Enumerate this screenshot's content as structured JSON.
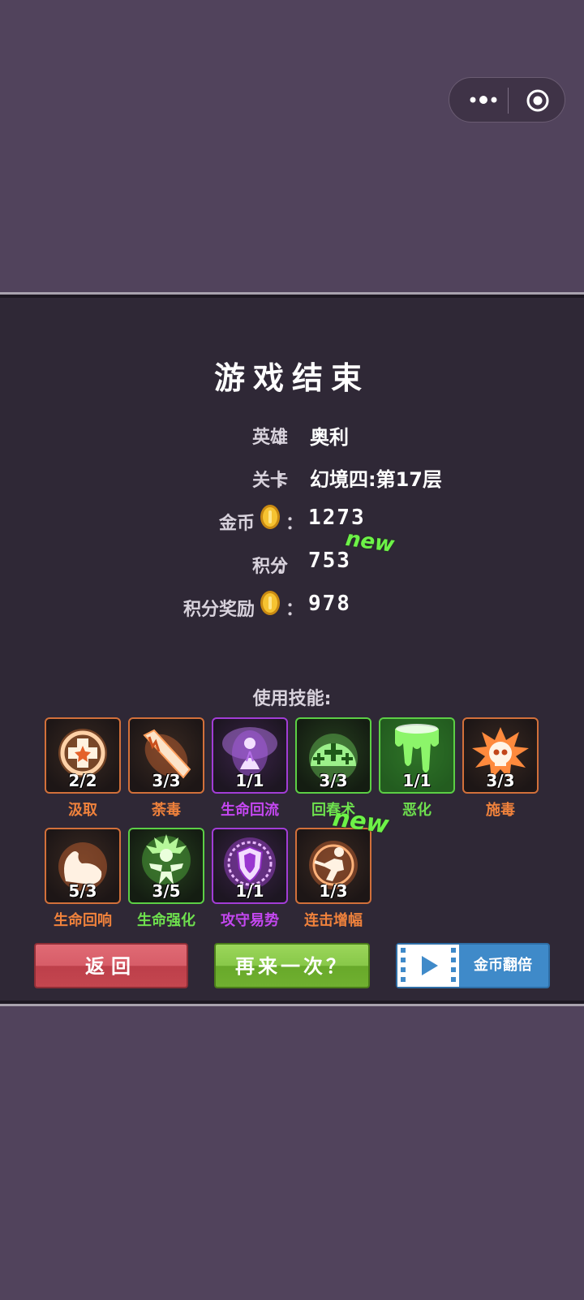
{
  "game_over": {
    "title": "游戏结束",
    "stats": {
      "hero_label": "英雄",
      "hero_value": "奥利",
      "level_label": "关卡",
      "level_value": "幻境四:第17层",
      "gold_label": "金币",
      "gold_value": "1273",
      "score_label": "积分",
      "score_value": "753",
      "score_new": "new",
      "reward_label": "积分奖励",
      "reward_value": "978",
      "colon": "："
    },
    "skills_heading": "使用技能:",
    "skills": [
      {
        "name": "汲取",
        "count": "2/2",
        "rarity": "orange",
        "icon": "cross-shield-icon"
      },
      {
        "name": "荼毒",
        "count": "3/3",
        "rarity": "orange",
        "icon": "blade-icon"
      },
      {
        "name": "生命回流",
        "count": "1/1",
        "rarity": "purple",
        "icon": "praying-figure-icon"
      },
      {
        "name": "回春术",
        "count": "3/3",
        "rarity": "green",
        "icon": "healing-orb-icon"
      },
      {
        "name": "恶化",
        "count": "1/1",
        "rarity": "green",
        "icon": "dripping-slime-icon"
      },
      {
        "name": "施毒",
        "count": "3/3",
        "rarity": "orange",
        "icon": "skull-burst-icon"
      },
      {
        "name": "生命回响",
        "count": "5/3",
        "rarity": "orange",
        "icon": "flexed-arm-icon"
      },
      {
        "name": "生命强化",
        "count": "3/5",
        "rarity": "green",
        "icon": "radiant-figure-icon"
      },
      {
        "name": "攻守易势",
        "count": "1/1",
        "rarity": "purple",
        "icon": "shield-emblem-icon"
      },
      {
        "name": "连击增幅",
        "count": "1/3",
        "rarity": "orange",
        "icon": "striking-fighter-icon"
      }
    ],
    "skill_new": "new",
    "buttons": {
      "back": "返回",
      "retry": "再来一次？",
      "double_gold": "金币翻倍"
    }
  },
  "colors": {
    "orange": "#f0823c",
    "purple": "#c447f0",
    "green": "#6ee04e"
  }
}
